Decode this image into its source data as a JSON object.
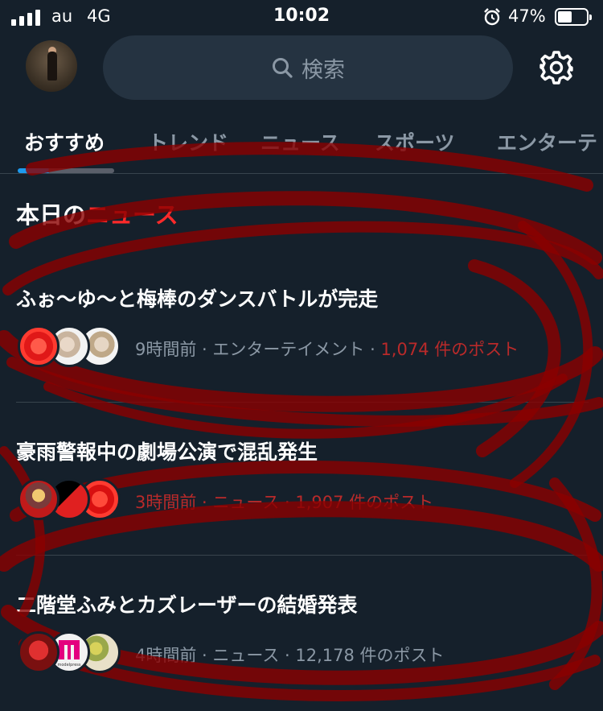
{
  "status_bar": {
    "carrier": "au",
    "network": "4G",
    "time": "10:02",
    "battery_percent": "47%",
    "battery_level": 0.47,
    "icons": [
      "signal-icon",
      "alarm-icon",
      "battery-icon"
    ]
  },
  "header": {
    "search_label": "検索",
    "icons": [
      "avatar",
      "search-icon",
      "gear-icon"
    ]
  },
  "tabs": [
    {
      "label": "おすすめ",
      "active": true
    },
    {
      "label": "トレンド",
      "active": false
    },
    {
      "label": "ニュース",
      "active": false
    },
    {
      "label": "スポーツ",
      "active": false
    },
    {
      "label": "エンターテ",
      "active": false
    }
  ],
  "section": {
    "title_part1": "本日の",
    "title_part2": "ニュース"
  },
  "news": [
    {
      "title": "ふぉ〜ゆ〜と梅棒のダンスバトルが完走",
      "time": "9時間前",
      "category": "エンターテイメント",
      "posts": "1,074 件のポスト"
    },
    {
      "title": "豪雨警報中の劇場公演で混乱発生",
      "time": "3時間前",
      "category": "ニュース",
      "posts": "1,907 件のポスト"
    },
    {
      "title": "二階堂ふみとカズレーザーの結婚発表",
      "time": "4時間前",
      "category": "ニュース",
      "posts": "12,178 件のポスト"
    }
  ],
  "thumb_texts": {
    "thumb_modelpress": "modelpress"
  },
  "colors": {
    "background": "#15202b",
    "search_bg": "#253341",
    "muted_text": "#8b98a5",
    "accent_blue": "#1d9bf0",
    "scribble_red": "#8b0000"
  },
  "separator": " · "
}
